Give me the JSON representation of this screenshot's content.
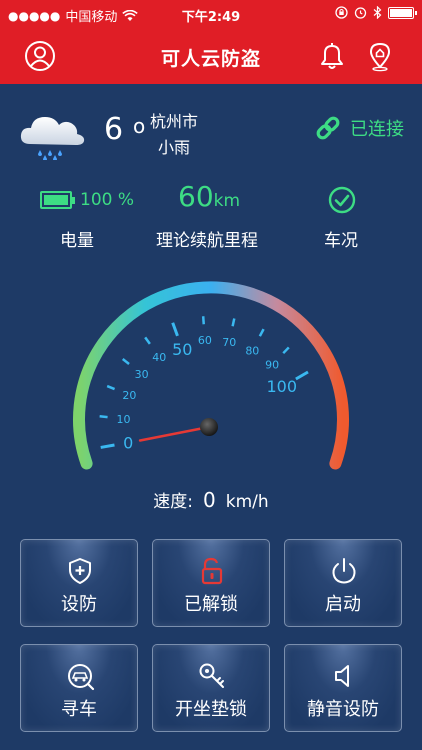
{
  "status_bar": {
    "carrier": "中国移动",
    "time": "下午2:49"
  },
  "header": {
    "title": "可人云防盗",
    "icons": [
      "user-icon",
      "bell-icon",
      "location-icon"
    ]
  },
  "weather": {
    "temperature": "6",
    "degree_mark": "o",
    "city": "杭州市",
    "condition": "小雨",
    "icon": "rain-cloud-icon"
  },
  "connection": {
    "status": "已连接",
    "icon": "link-icon",
    "color": "#3ddc84"
  },
  "stats": {
    "battery_value": "100 %",
    "battery_label": "电量",
    "battery_level": 1.0,
    "range_value": "60",
    "range_unit": "km",
    "range_label": "理论续航里程",
    "vehicle_label": "车况",
    "vehicle_icon": "check-circle-icon"
  },
  "gauge": {
    "min": 0,
    "max": 100,
    "value": 0,
    "ticks": [
      "0",
      "10",
      "20",
      "30",
      "40",
      "50",
      "60",
      "70",
      "80",
      "90",
      "100"
    ]
  },
  "speed": {
    "label": "速度:",
    "value": "0",
    "unit": "km/h"
  },
  "buttons": [
    {
      "label": "设防",
      "icon": "shield-plus-icon"
    },
    {
      "label": "已解锁",
      "icon": "unlock-icon"
    },
    {
      "label": "启动",
      "icon": "power-icon"
    },
    {
      "label": "寻车",
      "icon": "find-car-icon"
    },
    {
      "label": "开坐垫锁",
      "icon": "key-icon"
    },
    {
      "label": "静音设防",
      "icon": "speaker-icon"
    }
  ],
  "colors": {
    "header": "#e01e26",
    "background": "#1e3a66",
    "accent_green": "#3ddc84",
    "unlock_red": "#e53935"
  }
}
